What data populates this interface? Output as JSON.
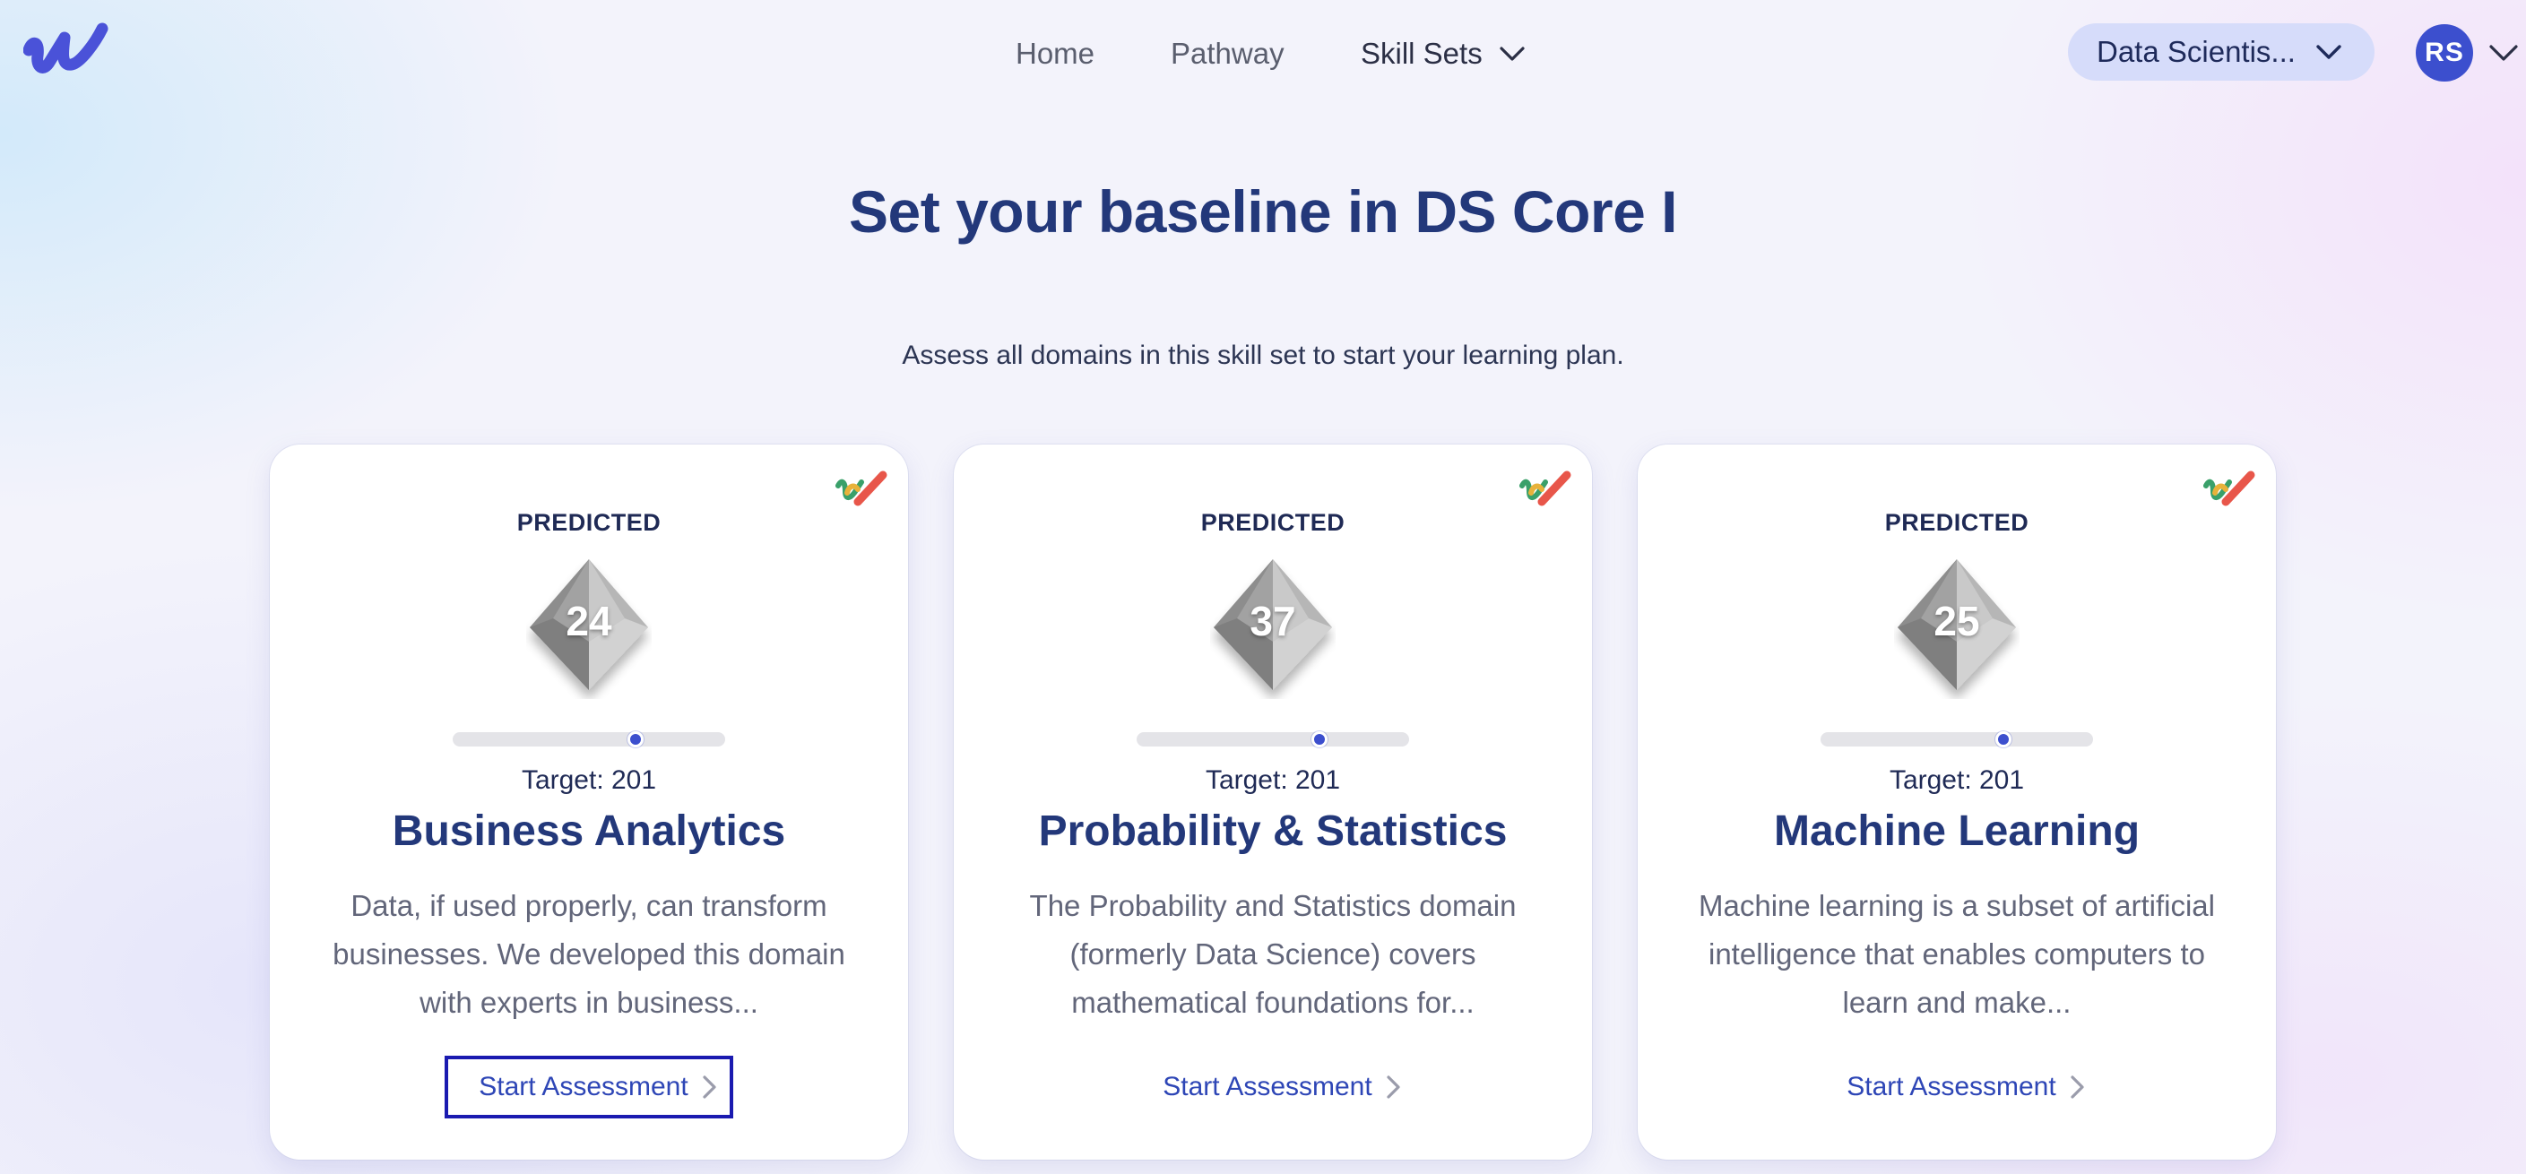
{
  "header": {
    "nav": {
      "home": "Home",
      "pathway": "Pathway",
      "skill_sets": "Skill Sets"
    },
    "domain_select": {
      "value": "Data Scientis..."
    },
    "user": {
      "initials": "RS"
    }
  },
  "page": {
    "title": "Set your baseline in DS Core I",
    "subtitle": "Assess all domains in this skill set to start your learning plan."
  },
  "colors": {
    "accent": "#3c4fce",
    "title": "#23387a",
    "select_bg": "#d6dcfa"
  },
  "cards": [
    {
      "predicted_label": "PREDICTED",
      "score": "24",
      "progress": 0.67,
      "target": "Target: 201",
      "name": "Business Analytics",
      "description": "Data, if used properly, can transform businesses. We developed this domain with experts in business...",
      "action": "Start Assessment",
      "focused": true
    },
    {
      "predicted_label": "PREDICTED",
      "score": "37",
      "progress": 0.67,
      "target": "Target: 201",
      "name": "Probability & Statistics",
      "description": "The Probability and Statistics domain (formerly Data Science) covers mathematical foundations for...",
      "action": "Start Assessment",
      "focused": false
    },
    {
      "predicted_label": "PREDICTED",
      "score": "25",
      "progress": 0.67,
      "target": "Target: 201",
      "name": "Machine Learning",
      "description": "Machine learning is a subset of artificial intelligence that enables computers to learn and make...",
      "action": "Start Assessment",
      "focused": false
    }
  ]
}
